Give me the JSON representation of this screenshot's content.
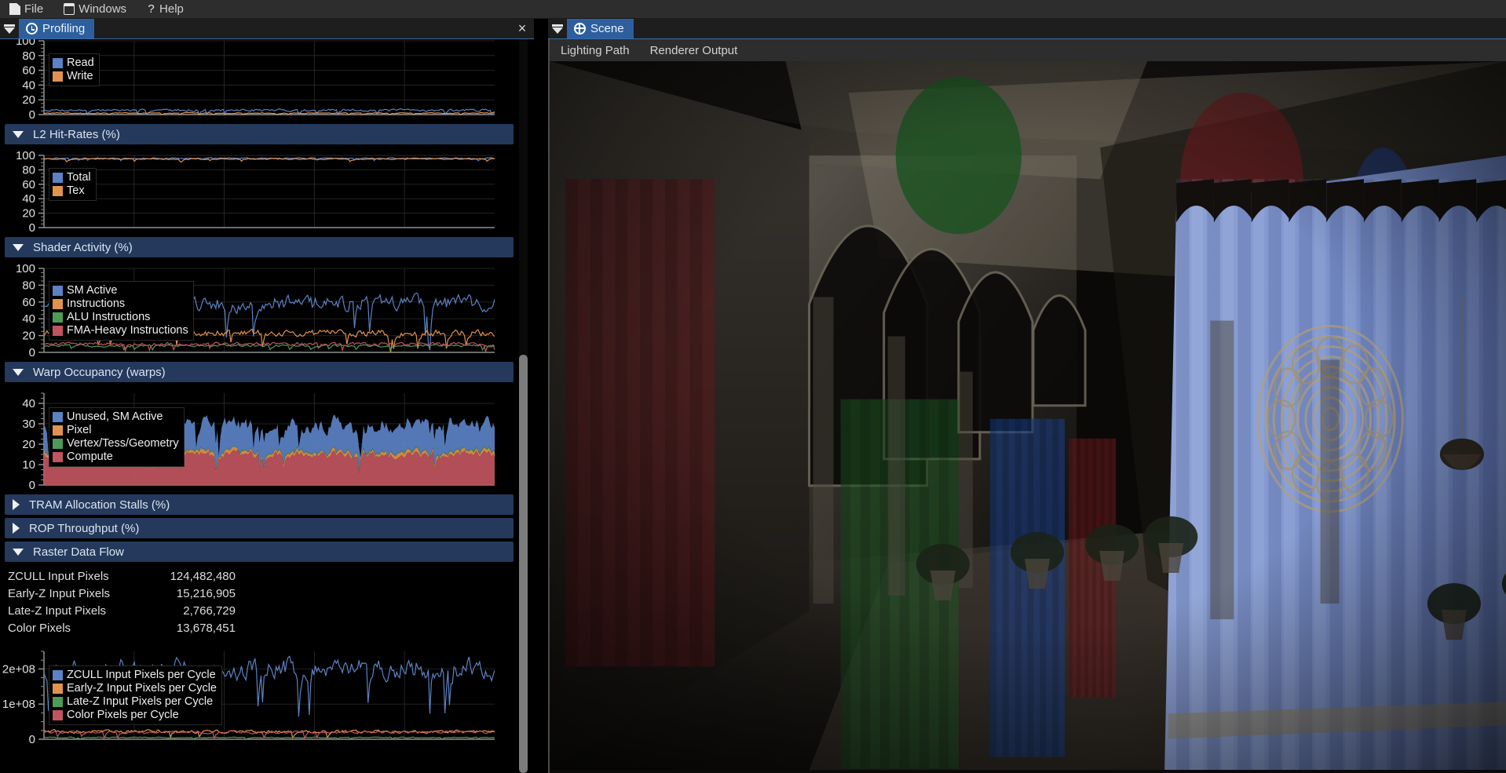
{
  "menubar": {
    "items": [
      {
        "label": "File",
        "icon": "document-icon"
      },
      {
        "label": "Windows",
        "icon": "window-icon"
      },
      {
        "label": "Help",
        "icon": "question-mark-icon"
      }
    ]
  },
  "left_panel": {
    "tab": {
      "label": "Profiling",
      "icon": "clock-icon"
    },
    "close_label": "×",
    "scroll": {
      "thumb_top_pct": 43,
      "thumb_height_pct": 57
    }
  },
  "right_panel": {
    "tab": {
      "label": "Scene",
      "icon": "globe-icon"
    },
    "toolbar": [
      {
        "label": "Lighting Path"
      },
      {
        "label": "Renderer Output"
      }
    ],
    "scene_description": "Sponza atrium rendered scene with colored hanging banners"
  },
  "colors": {
    "series_blue": "#5b82c4",
    "series_orange": "#e2924f",
    "series_green": "#4e9b57",
    "series_red": "#c0555f",
    "header_bar": "#24395c",
    "tab_active": "#2d5f9e",
    "panel_bg": "#000000",
    "grid": "#2a2a2a",
    "axis": "#9a9a9a"
  },
  "sections": [
    {
      "id": "dram",
      "title": "",
      "expanded": true,
      "has_header": false
    },
    {
      "id": "l2",
      "title": "L2 Hit-Rates (%)",
      "expanded": true,
      "has_header": true
    },
    {
      "id": "shader",
      "title": "Shader Activity (%)",
      "expanded": true,
      "has_header": true
    },
    {
      "id": "warp",
      "title": "Warp Occupancy (warps)",
      "expanded": true,
      "has_header": true
    },
    {
      "id": "tram",
      "title": "TRAM Allocation Stalls (%)",
      "expanded": false,
      "has_header": true
    },
    {
      "id": "rop",
      "title": "ROP Throughput (%)",
      "expanded": false,
      "has_header": true
    },
    {
      "id": "raster",
      "title": "Raster Data Flow",
      "expanded": true,
      "has_header": true
    }
  ],
  "raster_stats": {
    "rows": [
      {
        "label": "ZCULL Input Pixels",
        "value": "124,482,480"
      },
      {
        "label": "Early-Z Input Pixels",
        "value": "15,216,905"
      },
      {
        "label": "Late-Z Input Pixels",
        "value": "2,766,729"
      },
      {
        "label": "Color Pixels",
        "value": "13,678,451"
      }
    ]
  },
  "chart_data": [
    {
      "id": "dram",
      "type": "line",
      "title": "",
      "ylabel": "",
      "ylim": [
        0,
        100
      ],
      "yticks": [
        0,
        20,
        40,
        60,
        80,
        100
      ],
      "ytick_labels": [
        "0",
        "20",
        "40",
        "60",
        "80",
        "100"
      ],
      "grid": true,
      "legend_position": "top-left",
      "series": [
        {
          "name": "Read",
          "color": "#5b82c4",
          "mean": 6,
          "amplitude": 2.5
        },
        {
          "name": "Write",
          "color": "#e2924f",
          "mean": 2,
          "amplitude": 1.0
        }
      ]
    },
    {
      "id": "l2",
      "type": "line",
      "title": "L2 Hit-Rates (%)",
      "ylabel": "",
      "ylim": [
        0,
        100
      ],
      "yticks": [
        0,
        20,
        40,
        60,
        80,
        100
      ],
      "ytick_labels": [
        "0",
        "20",
        "40",
        "60",
        "80",
        "100"
      ],
      "grid": true,
      "legend_position": "top-left",
      "series": [
        {
          "name": "Total",
          "color": "#5b82c4",
          "mean": 96,
          "amplitude": 1.2
        },
        {
          "name": "Tex",
          "color": "#e2924f",
          "mean": 95,
          "amplitude": 1.2
        }
      ]
    },
    {
      "id": "shader",
      "type": "line",
      "title": "Shader Activity (%)",
      "ylabel": "",
      "ylim": [
        0,
        100
      ],
      "yticks": [
        0,
        20,
        40,
        60,
        80,
        100
      ],
      "ytick_labels": [
        "0",
        "20",
        "40",
        "60",
        "80",
        "100"
      ],
      "grid": true,
      "legend_position": "top-left",
      "series": [
        {
          "name": "SM Active",
          "color": "#5b82c4",
          "mean": 58,
          "amplitude": 14
        },
        {
          "name": "Instructions",
          "color": "#e2924f",
          "mean": 23,
          "amplitude": 6
        },
        {
          "name": "ALU Instructions",
          "color": "#4e9b57",
          "mean": 8,
          "amplitude": 2
        },
        {
          "name": "FMA-Heavy Instructions",
          "color": "#c0555f",
          "mean": 10,
          "amplitude": 3
        }
      ]
    },
    {
      "id": "warp",
      "type": "area",
      "title": "Warp Occupancy (warps)",
      "ylabel": "",
      "ylim": [
        0,
        45
      ],
      "yticks": [
        0,
        10,
        20,
        30,
        40
      ],
      "ytick_labels": [
        "0",
        "10",
        "20",
        "30",
        "40"
      ],
      "grid": true,
      "legend_position": "top-left",
      "series": [
        {
          "name": "Unused, SM Active",
          "color": "#5b82c4",
          "mean": 13,
          "amplitude": 5
        },
        {
          "name": "Pixel",
          "color": "#e2924f",
          "mean": 1.5,
          "amplitude": 1
        },
        {
          "name": "Vertex/Tess/Geometry",
          "color": "#4e9b57",
          "mean": 0.4,
          "amplitude": 0.3
        },
        {
          "name": "Compute",
          "color": "#c0555f",
          "mean": 15,
          "amplitude": 3
        }
      ]
    },
    {
      "id": "raster",
      "type": "line",
      "title": "Raster Data Flow",
      "ylabel": "",
      "ylim": [
        0,
        250000000
      ],
      "yticks": [
        0,
        100000000,
        200000000
      ],
      "ytick_labels": [
        "0",
        "1e+08",
        "2e+08"
      ],
      "grid": true,
      "legend_position": "top-left",
      "series": [
        {
          "name": "ZCULL Input Pixels per Cycle",
          "color": "#5b82c4",
          "mean": 200000000,
          "amplitude": 45000000
        },
        {
          "name": "Early-Z Input Pixels per Cycle",
          "color": "#e2924f",
          "mean": 22000000,
          "amplitude": 7000000
        },
        {
          "name": "Late-Z Input Pixels per Cycle",
          "color": "#4e9b57",
          "mean": 5000000,
          "amplitude": 2000000
        },
        {
          "name": "Color Pixels per Cycle",
          "color": "#c0555f",
          "mean": 20000000,
          "amplitude": 6000000
        }
      ]
    }
  ]
}
